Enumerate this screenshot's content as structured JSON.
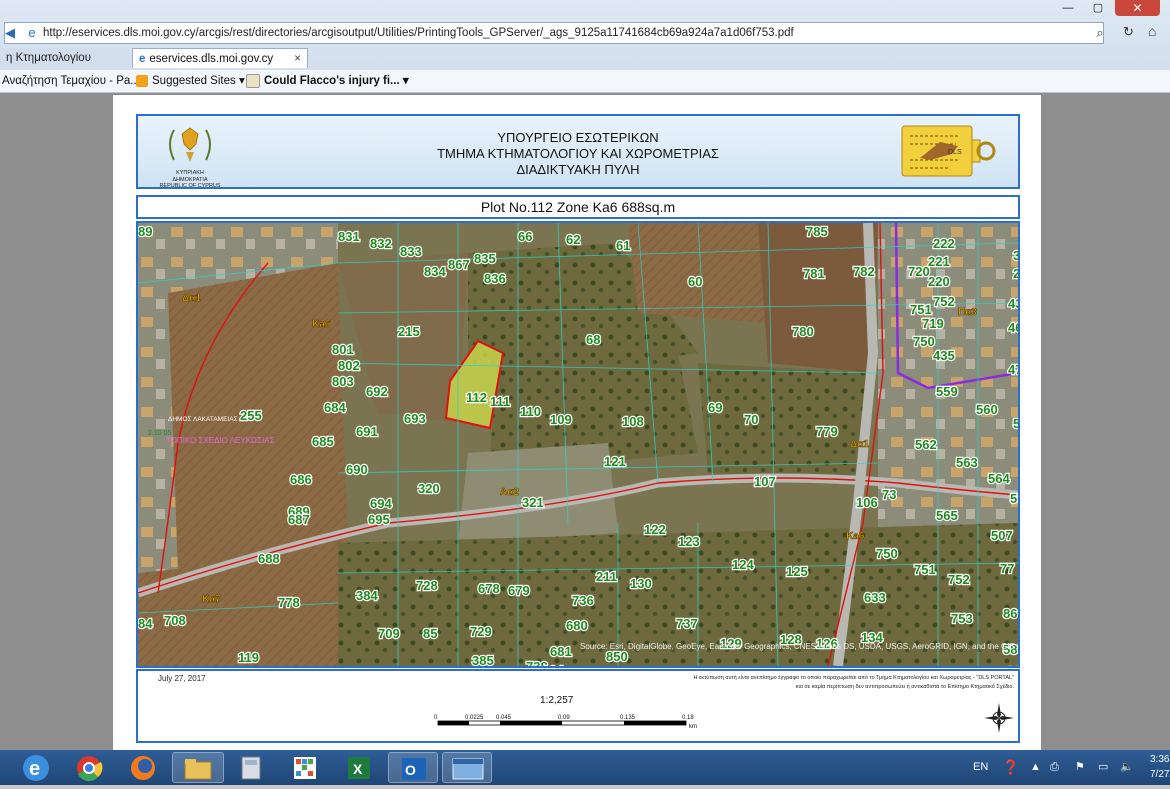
{
  "browser": {
    "address_url": "http://eservices.dls.moi.gov.cy/arcgis/rest/directories/arcgisoutput/Utilities/PrintingTools_GPServer/_ags_9125a11741684cb69a924a7a1d06f753.pdf",
    "tabs": [
      {
        "label": "η Κτηματολογίου"
      },
      {
        "label": "eservices.dls.moi.gov.cy",
        "close": "×"
      }
    ],
    "favorites": [
      {
        "label": "Αναζήτηση Τεμαχίου - Pa..."
      },
      {
        "label": "Suggested Sites ▾"
      },
      {
        "label": "Could Flacco's injury fi... ▾"
      }
    ]
  },
  "document": {
    "header": {
      "line1": "ΥΠΟΥΡΓΕΙΟ ΕΣΩΤΕΡΙΚΩΝ",
      "line2": "ΤΜΗΜΑ ΚΤΗΜΑΤΟΛΟΓΙΟΥ ΚΑΙ ΧΩΡΟΜΕΤΡΙΑΣ",
      "line3": "ΔΙΑΔΙΚΤΥΑΚΗ ΠΥΛΗ",
      "emblem_text1": "ΚΥΠΡΙΑΚΗ ΔΗΜΟΚΡΑΤΙΑ",
      "emblem_text2": "REPUBLIC OF CYPRUS",
      "logo_text": "DLS"
    },
    "plot_title": "Plot No.112 Zone Ka6 688sq.m",
    "map": {
      "parcels": [
        "831",
        "832",
        "833",
        "834",
        "867",
        "835",
        "836",
        "66",
        "62",
        "61",
        "60",
        "785",
        "781",
        "782",
        "720",
        "222",
        "221",
        "370",
        "214",
        "220",
        "751",
        "752",
        "434",
        "719",
        "462",
        "750",
        "435",
        "477",
        "215",
        "68",
        "780",
        "801",
        "802",
        "803",
        "692",
        "684",
        "691",
        "693",
        "112",
        "111",
        "110",
        "109",
        "108",
        "69",
        "70",
        "779",
        "559",
        "560",
        "561",
        "255",
        "562",
        "563",
        "564",
        "685",
        "690",
        "121",
        "107",
        "106",
        "73",
        "506",
        "565",
        "686",
        "320",
        "321",
        "689",
        "694",
        "687",
        "695",
        "122",
        "123",
        "507",
        "124",
        "750",
        "751",
        "752",
        "77",
        "688",
        "728",
        "678",
        "679",
        "736",
        "211",
        "130",
        "125",
        "778",
        "384",
        "633",
        "753",
        "86",
        "85",
        "729",
        "680",
        "737",
        "129",
        "128",
        "126",
        "134",
        "583",
        "84",
        "708",
        "709",
        "119",
        "385",
        "681",
        "738",
        "850",
        "104",
        "127",
        "89"
      ],
      "zones": [
        "Δα1",
        "Ka6",
        "Πα3",
        "Δα1",
        "Αα2",
        "Ka6",
        "Κα7",
        "Δα1"
      ],
      "zone_text": [
        "ΔΗΜΟΣ ΛΑΚΑΤΑΜΕΙΑΣ",
        "ΤΟΠΙΚΟ ΣΧΕΔΙΟ ΛΕΥΚΩΣΙΑΣ",
        "2.10 05"
      ],
      "attribution": "Source: Esri, DigitalGlobe, GeoEye, Earthstar Geographics, CNES/Airbus DS, USDA, USGS, AeroGRID, IGN, and the GIS User Community"
    },
    "footer": {
      "date": "July 27, 2017",
      "disclaimer1": "Η εκτύπωση αυτή είναι ανεπίσημο έγγραφο το οποίο παραχωρείται από το Τμήμα Κτηματολογίου και Χωρομετρίας - \"DLS PORTAL\"",
      "disclaimer2": "και σε καμία περίπτωση δεν αντιπροσωπεύει ή αντικαθιστά το Επίσημο Κτηματικό Σχέδιο.",
      "scale": "1:2,257",
      "scale_ticks": [
        "0",
        "0.0225",
        "0.045",
        "0.09",
        "0.135",
        "0.18"
      ],
      "scale_unit": "km"
    }
  },
  "taskbar": {
    "lang": "EN",
    "time": "3:36",
    "date": "7/27/"
  },
  "colors": {
    "map_border": "#2a6fc9",
    "parcel_label": "#1f8a1f",
    "zone_label": "#e8b400",
    "highlight": "#c8d44a",
    "boundary_red": "#e01010",
    "zone_purple": "#8a2be2"
  }
}
